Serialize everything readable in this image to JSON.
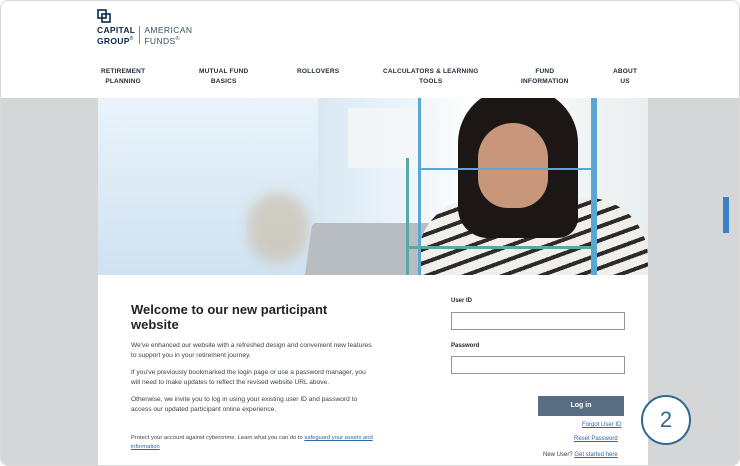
{
  "logo": {
    "brand_line1": "CAPITAL",
    "brand_line2": "GROUP",
    "brand_reg": "®",
    "sub_line1": "AMERICAN",
    "sub_line2": "FUNDS",
    "sub_reg": "®",
    "icon": "capital-group-logo-icon"
  },
  "nav": {
    "items": [
      {
        "line1": "RETIREMENT",
        "line2": "PLANNING"
      },
      {
        "line1": "MUTUAL FUND",
        "line2": "BASICS"
      },
      {
        "line1": "ROLLOVERS",
        "line2": ""
      },
      {
        "line1": "CALCULATORS & LEARNING",
        "line2": "TOOLS"
      },
      {
        "line1": "FUND",
        "line2": "INFORMATION"
      },
      {
        "line1": "ABOUT",
        "line2": "US"
      }
    ]
  },
  "welcome": {
    "title": "Welcome to our new participant website",
    "p1": "We've enhanced our website with a refreshed design and convenient new features to support you in your retirement journey.",
    "p2": "If you've previously bookmarked the login page or use a password manager, you will need to make updates to reflect the revised website URL above.",
    "p3": "Otherwise, we invite you to log in using your existing user ID and password to access our updated participant online experience.",
    "protect_text": "Protect your account against cybercrime. Learn what you can do to ",
    "protect_link": "safeguard your assets and information"
  },
  "form": {
    "userid_label": "User ID",
    "userid_value": "",
    "password_label": "Password",
    "password_value": "",
    "login_label": "Log in",
    "forgot_userid": "Forgot User ID",
    "reset_password": "Reset Password",
    "new_user_text": "New User? ",
    "get_started": "Get started here"
  },
  "badge": {
    "number": "2"
  },
  "colors": {
    "accent_blue": "#5aa7d6",
    "accent_teal": "#58a9a6",
    "button": "#596d82",
    "link": "#2f66a8",
    "badge": "#2c6a8f"
  }
}
